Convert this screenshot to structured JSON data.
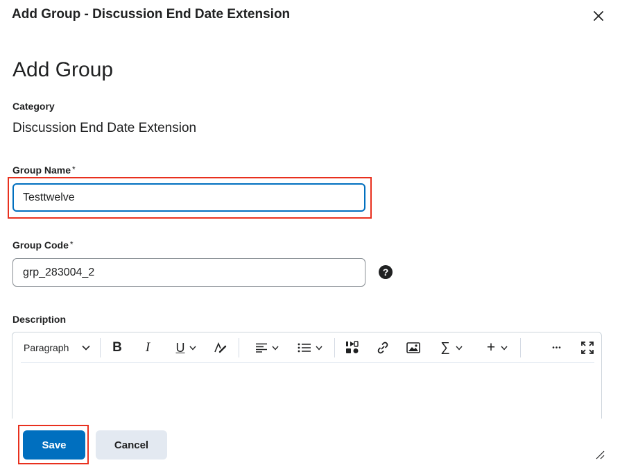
{
  "dialog": {
    "title": "Add Group - Discussion End Date Extension"
  },
  "page": {
    "heading": "Add Group"
  },
  "category": {
    "label": "Category",
    "value": "Discussion End Date Extension"
  },
  "group_name": {
    "label": "Group Name",
    "required_mark": "*",
    "value": "Testtwelve"
  },
  "group_code": {
    "label": "Group Code",
    "required_mark": "*",
    "value": "grp_283004_2",
    "help_glyph": "?"
  },
  "description": {
    "label": "Description",
    "toolbar": {
      "block_format": "Paragraph",
      "bold": "B",
      "italic": "I",
      "underline": "U",
      "sigma": "∑",
      "plus": "+",
      "more": "•••"
    }
  },
  "actions": {
    "save_label": "Save",
    "cancel_label": "Cancel"
  },
  "colors": {
    "primary": "#006fbf",
    "highlight": "#e8301e",
    "secondary_bg": "#e3e9f1",
    "text": "#202122"
  }
}
